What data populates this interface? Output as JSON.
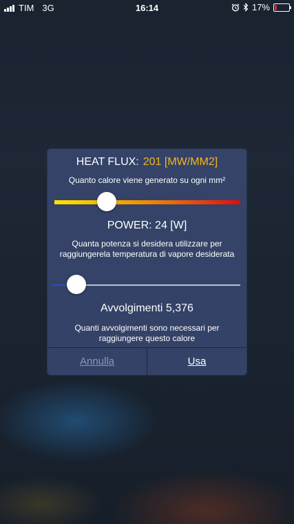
{
  "status_bar": {
    "carrier": "TIM",
    "network": "3G",
    "time": "16:14",
    "battery_percent": "17%",
    "battery_level": 0.17,
    "battery_color": "#e22222",
    "icons": [
      "signal-icon",
      "alarm-icon",
      "bluetooth-icon",
      "battery-icon"
    ]
  },
  "dialog": {
    "heat_flux": {
      "label": "HEAT FLUX:",
      "value": "201 [MW/MM2]",
      "value_color": "#f5b61e",
      "description": "Quanto calore viene generato su ogni mm²",
      "slider_fraction": 0.28
    },
    "power": {
      "label": "POWER: 24 [W]",
      "description": "Quanta potenza si desidera utilizzare per raggiungerela temperatura di vapore desiderata",
      "slider_fraction": 0.12
    },
    "coils": {
      "label": "Avvolgimenti 5,376",
      "description": "Quanti avvolgimenti sono necessari per raggiungere questo calore"
    },
    "buttons": {
      "cancel_label": "Annulla",
      "use_label": "Usa"
    }
  }
}
